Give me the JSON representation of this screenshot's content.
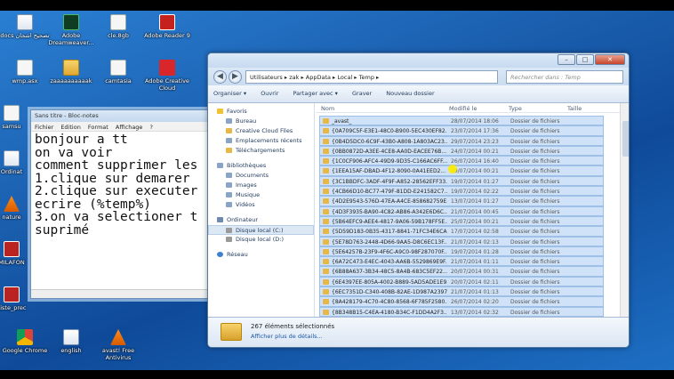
{
  "desktop_icons": [
    {
      "label": "docs تصحيح اشجان",
      "icon": "document-icon"
    },
    {
      "label": "Adobe Dreamweaver...",
      "icon": "dreamweaver-icon"
    },
    {
      "label": "cle.8gb",
      "icon": "file-icon"
    },
    {
      "label": "Adobe Reader 9",
      "icon": "pdf-icon"
    },
    {
      "label": "wmp.asx",
      "icon": "file-icon"
    },
    {
      "label": "zaaaaaaaaaak",
      "icon": "folder-icon"
    },
    {
      "label": "camtasia",
      "icon": "file-icon"
    },
    {
      "label": "Adobe Creative Cloud",
      "icon": "creative-cloud-icon"
    },
    {
      "label": "samsu",
      "icon": "file-icon"
    },
    {
      "label": "Ordinat",
      "icon": "computer-icon"
    },
    {
      "label": "nature",
      "icon": "vlc-icon"
    },
    {
      "label": "MILAFON",
      "icon": "file-icon"
    },
    {
      "label": "Liste_prec",
      "icon": "file-icon"
    },
    {
      "label": "Google Chrome",
      "icon": "chrome-icon"
    },
    {
      "label": "english",
      "icon": "document-icon"
    },
    {
      "label": "avast! Free Antivirus",
      "icon": "avast-icon"
    }
  ],
  "notepad": {
    "title": "Sans titre - Bloc-notes",
    "menu": [
      "Fichier",
      "Edition",
      "Format",
      "Affichage",
      "?"
    ],
    "text": "bonjour a tt\non va voir\ncomment supprimer les\n1.clique sur demarer\n2.clique sur executer\necrire (%temp%)\n3.on va selectioner t\nsuprimé"
  },
  "explorer": {
    "address": "Utilisateurs  ▸  zak  ▸  AppData  ▸  Local  ▸  Temp  ▸",
    "search_placeholder": "Rechercher dans : Temp",
    "toolbar": [
      "Organiser ▾",
      "Ouvrir",
      "Partager avec ▾",
      "Graver",
      "Nouveau dossier"
    ],
    "nav": {
      "favorites_header": "Favoris",
      "favorites": [
        "Bureau",
        "Creative Cloud Files",
        "Emplacements récents",
        "Téléchargements"
      ],
      "libraries_header": "Bibliothèques",
      "libraries": [
        "Documents",
        "Images",
        "Musique",
        "Vidéos"
      ],
      "computer_header": "Ordinateur",
      "drives": [
        "Disque local (C:)",
        "Disque local (D:)"
      ],
      "network": "Réseau"
    },
    "columns": [
      "Nom",
      "Modifié le",
      "Type",
      "Taille"
    ],
    "rows": [
      {
        "name": "_avast_",
        "date": "28/07/2014 18:06",
        "type": "Dossier de fichiers"
      },
      {
        "name": "{0A709C5F-E3E1-48C0-B900-5EC430EF82...",
        "date": "23/07/2014 17:36",
        "type": "Dossier de fichiers"
      },
      {
        "name": "{0B4D5DC0-6C9F-43B0-A808-1A803AC23...",
        "date": "29/07/2014 23:23",
        "type": "Dossier de fichiers"
      },
      {
        "name": "{0BB0872D-A3EE-4CE8-AA0D-EACEE76B...",
        "date": "24/07/2014 00:21",
        "type": "Dossier de fichiers"
      },
      {
        "name": "{1C0CF906-AFC4-49D9-9D35-C166AC6FF...",
        "date": "26/07/2014 16:40",
        "type": "Dossier de fichiers"
      },
      {
        "name": "{1EEA15AF-DBAD-4F12-8090-0A41EED2...",
        "date": "29/07/2014 00:21",
        "type": "Dossier de fichiers"
      },
      {
        "name": "{3C1BBDFC-3ADF-4F9F-A852-28562EFF33...",
        "date": "19/07/2014 01:27",
        "type": "Dossier de fichiers"
      },
      {
        "name": "{4CB66D10-BC77-479F-81DD-E241582C7...",
        "date": "19/07/2014 02:22",
        "type": "Dossier de fichiers"
      },
      {
        "name": "{4D2E9543-576D-47EA-A4CE-858682759E...",
        "date": "13/07/2014 01:27",
        "type": "Dossier de fichiers"
      },
      {
        "name": "{4D3F3935-BA90-4C82-AB86-A342E6D6C...",
        "date": "21/07/2014 00:45",
        "type": "Dossier de fichiers"
      },
      {
        "name": "{5B64EFC9-AEE4-4817-9A06-59B178FF5E...",
        "date": "25/07/2014 00:21",
        "type": "Dossier de fichiers"
      },
      {
        "name": "{5D59D183-0B35-4317-8841-71FC34E6CA...",
        "date": "17/07/2014 02:58",
        "type": "Dossier de fichiers"
      },
      {
        "name": "{5E78D763-2448-4D66-9AA5-D8C6EC13F...",
        "date": "21/07/2014 02:13",
        "type": "Dossier de fichiers"
      },
      {
        "name": "{5E64257B-23F9-4F6C-A9C0-98F287070F...",
        "date": "19/07/2014 01:28",
        "type": "Dossier de fichiers"
      },
      {
        "name": "{6A72C473-E4EC-4043-AA6B-5529869E9F...",
        "date": "21/07/2014 01:11",
        "type": "Dossier de fichiers"
      },
      {
        "name": "{6B88A637-3B34-48C5-8A4B-683C5EF22...",
        "date": "20/07/2014 00:31",
        "type": "Dossier de fichiers"
      },
      {
        "name": "{6E4397EE-805A-4002-B889-5AD5ADE1E9...",
        "date": "20/07/2014 02:11",
        "type": "Dossier de fichiers"
      },
      {
        "name": "{6EC7351D-C340-408B-82AE-1D987A2397...",
        "date": "21/07/2014 01:13",
        "type": "Dossier de fichiers"
      },
      {
        "name": "{8A428179-4C70-4C80-8568-6F785F2580...",
        "date": "26/07/2014 02:20",
        "type": "Dossier de fichiers"
      },
      {
        "name": "{8B348B15-C4EA-4180-B34C-F1DD4A2F3...",
        "date": "13/07/2014 02:32",
        "type": "Dossier de fichiers"
      }
    ],
    "details": {
      "count": "267 éléments sélectionnés",
      "link": "Afficher plus de détails..."
    }
  }
}
